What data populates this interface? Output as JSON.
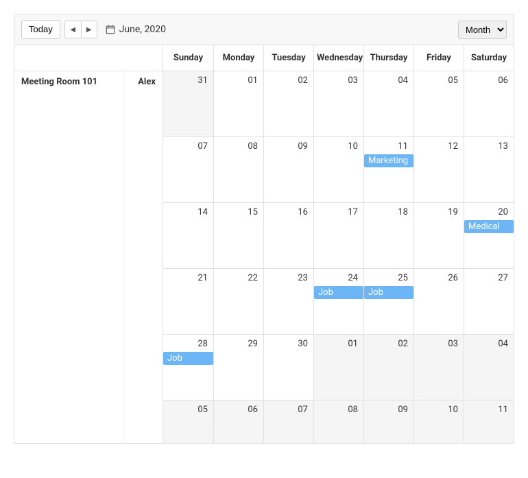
{
  "toolbar": {
    "today_label": "Today",
    "date_label": "June, 2020",
    "view_selected": "Month"
  },
  "resources": {
    "group": "Meeting Room 101",
    "owner": "Alex"
  },
  "day_headers": [
    "Sunday",
    "Monday",
    "Tuesday",
    "Wednesday",
    "Thursday",
    "Friday",
    "Saturday"
  ],
  "weeks": [
    [
      {
        "num": "31",
        "out": true
      },
      {
        "num": "01"
      },
      {
        "num": "02"
      },
      {
        "num": "03"
      },
      {
        "num": "04"
      },
      {
        "num": "05"
      },
      {
        "num": "06"
      }
    ],
    [
      {
        "num": "07"
      },
      {
        "num": "08"
      },
      {
        "num": "09"
      },
      {
        "num": "10"
      },
      {
        "num": "11",
        "event": "Marketing"
      },
      {
        "num": "12"
      },
      {
        "num": "13"
      }
    ],
    [
      {
        "num": "14"
      },
      {
        "num": "15"
      },
      {
        "num": "16"
      },
      {
        "num": "17"
      },
      {
        "num": "18"
      },
      {
        "num": "19"
      },
      {
        "num": "20",
        "event": "Medical"
      }
    ],
    [
      {
        "num": "21"
      },
      {
        "num": "22"
      },
      {
        "num": "23"
      },
      {
        "num": "24",
        "event": "Job"
      },
      {
        "num": "25",
        "event": "Job"
      },
      {
        "num": "26"
      },
      {
        "num": "27"
      }
    ],
    [
      {
        "num": "28",
        "event": "Job"
      },
      {
        "num": "29"
      },
      {
        "num": "30"
      },
      {
        "num": "01",
        "out": true
      },
      {
        "num": "02",
        "out": true
      },
      {
        "num": "03",
        "out": true
      },
      {
        "num": "04",
        "out": true
      }
    ],
    [
      {
        "num": "05",
        "out": true
      },
      {
        "num": "06",
        "out": true
      },
      {
        "num": "07",
        "out": true
      },
      {
        "num": "08",
        "out": true
      },
      {
        "num": "09",
        "out": true
      },
      {
        "num": "10",
        "out": true
      },
      {
        "num": "11",
        "out": true
      }
    ]
  ]
}
